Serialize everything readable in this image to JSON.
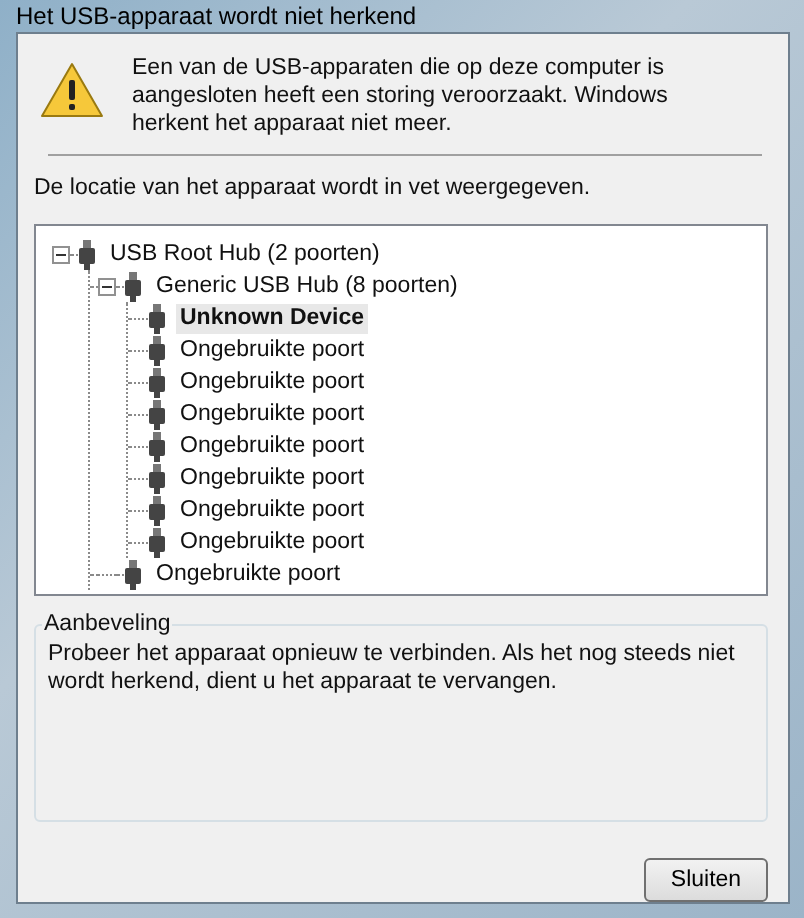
{
  "window": {
    "title": "Het USB-apparaat wordt niet herkend"
  },
  "message": "Een van de USB-apparaten die op deze computer is aangesloten heeft een storing veroorzaakt. Windows herkent het apparaat niet meer.",
  "location_note": "De locatie van het apparaat wordt in vet weergegeven.",
  "tree": [
    {
      "label": "USB Root Hub (2 poorten)",
      "expanded": true,
      "selected": false,
      "children": [
        {
          "label": "Generic USB Hub (8 poorten)",
          "expanded": true,
          "selected": false,
          "children": [
            {
              "label": "Unknown Device",
              "selected": true
            },
            {
              "label": "Ongebruikte poort",
              "selected": false
            },
            {
              "label": "Ongebruikte poort",
              "selected": false
            },
            {
              "label": "Ongebruikte poort",
              "selected": false
            },
            {
              "label": "Ongebruikte poort",
              "selected": false
            },
            {
              "label": "Ongebruikte poort",
              "selected": false
            },
            {
              "label": "Ongebruikte poort",
              "selected": false
            },
            {
              "label": "Ongebruikte poort",
              "selected": false
            }
          ]
        },
        {
          "label": "Ongebruikte poort",
          "selected": false
        }
      ]
    }
  ],
  "recommendation": {
    "title": "Aanbeveling",
    "text": "Probeer het apparaat opnieuw te verbinden. Als het nog steeds niet wordt herkend, dient u het apparaat te vervangen."
  },
  "buttons": [
    "Sluiten"
  ]
}
